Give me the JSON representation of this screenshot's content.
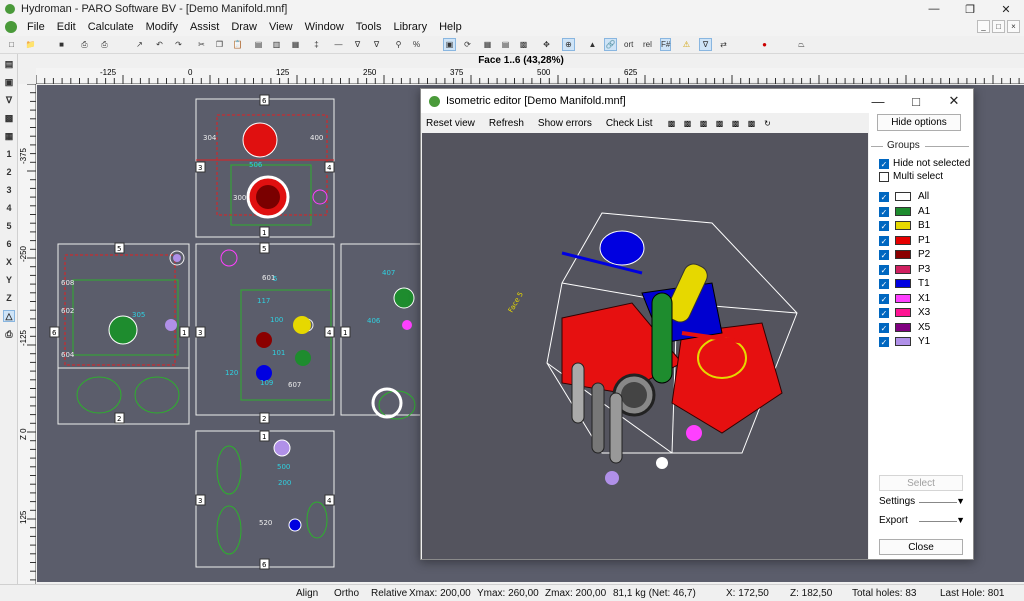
{
  "app": {
    "title": "Hydroman - PARO Software BV - [Demo Manifold.mnf]"
  },
  "menu": [
    "File",
    "Edit",
    "Calculate",
    "Modify",
    "Assist",
    "Draw",
    "View",
    "Window",
    "Tools",
    "Library",
    "Help"
  ],
  "toolbar": {
    "ort": "ort",
    "rel": "rel",
    "fhash": "F#"
  },
  "left_toolbar": [
    "1",
    "2",
    "3",
    "4",
    "5",
    "6",
    "X",
    "Y",
    "Z"
  ],
  "face": {
    "label": "Face 1..6  (43,28%)"
  },
  "ruler": {
    "h": [
      "-125",
      "0",
      "125",
      "250",
      "375",
      "500",
      "625"
    ],
    "v": [
      "-375",
      "-250",
      "-125",
      "Z 0",
      "125"
    ]
  },
  "dialog": {
    "title": "Isometric editor [Demo Manifold.mnf]",
    "menu": [
      "Reset view",
      "Refresh",
      "Show errors",
      "Check List"
    ],
    "hide_options": "Hide options",
    "groups_label": "Groups",
    "hide_not_selected": "Hide not selected",
    "multi_select": "Multi select",
    "groups": [
      {
        "name": "All",
        "color": "#ffffff"
      },
      {
        "name": "A1",
        "color": "#1e8c2e"
      },
      {
        "name": "B1",
        "color": "#e6d800"
      },
      {
        "name": "P1",
        "color": "#e60000"
      },
      {
        "name": "P2",
        "color": "#8b0000"
      },
      {
        "name": "P3",
        "color": "#d02060"
      },
      {
        "name": "T1",
        "color": "#0000e0"
      },
      {
        "name": "X1",
        "color": "#ff40ff"
      },
      {
        "name": "X3",
        "color": "#ff1493"
      },
      {
        "name": "X5",
        "color": "#800080"
      },
      {
        "name": "Y1",
        "color": "#b090e8"
      }
    ],
    "select": "Select",
    "settings": "Settings",
    "export": "Export",
    "close": "Close",
    "face_label": "Face 5"
  },
  "status": {
    "align": "Align",
    "ortho": "Ortho",
    "relative": "Relative",
    "xmax": "Xmax: 200,00",
    "ymax": "Ymax: 260,00",
    "zmax": "Zmax: 200,00",
    "mass": "81,1 kg (Net: 46,7)",
    "x": "X: 172,50",
    "z": "Z: 182,50",
    "total_holes": "Total holes: 83",
    "last_hole": "Last Hole: 801"
  }
}
